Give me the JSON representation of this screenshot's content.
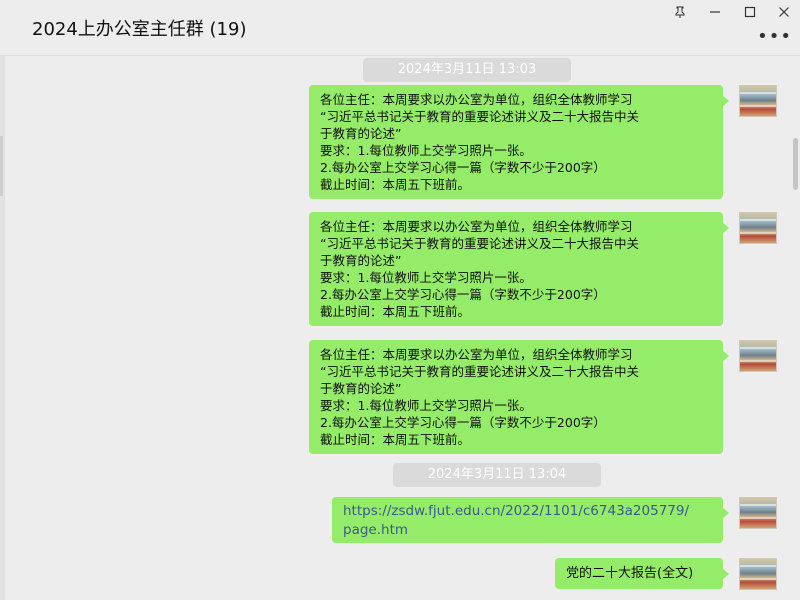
{
  "window": {
    "title": "2024上办公室主任群 (19)",
    "pin_icon": "pin-icon",
    "minimize_icon": "minimize-icon",
    "maximize_icon": "maximize-icon",
    "close_icon": "close-icon",
    "more_icon": "more-icon"
  },
  "chat": {
    "timestamps": [
      "2024年3月11日  13:03",
      "2024年3月11日  13:04"
    ],
    "message_lines": [
      "各位主任：本周要求以办公室为单位，组织全体教师学习",
      "“习近平总书记关于教育的重要论述讲义及二十大报告中关",
      "于教育的论述”",
      "要求：1.每位教师上交学习照片一张。",
      "2.每办公室上交学习心得一篇（字数不少于200字）",
      "截止时间：本周五下班前。"
    ],
    "link_lines": [
      "https://zsdw.fjut.edu.cn/2022/1101/c6743a205779/",
      "page.htm"
    ],
    "last_message": "党的二十大报告(全文)"
  },
  "colors": {
    "bubble": "#95ec69",
    "background": "#ededed",
    "link": "#3c5a8a"
  }
}
